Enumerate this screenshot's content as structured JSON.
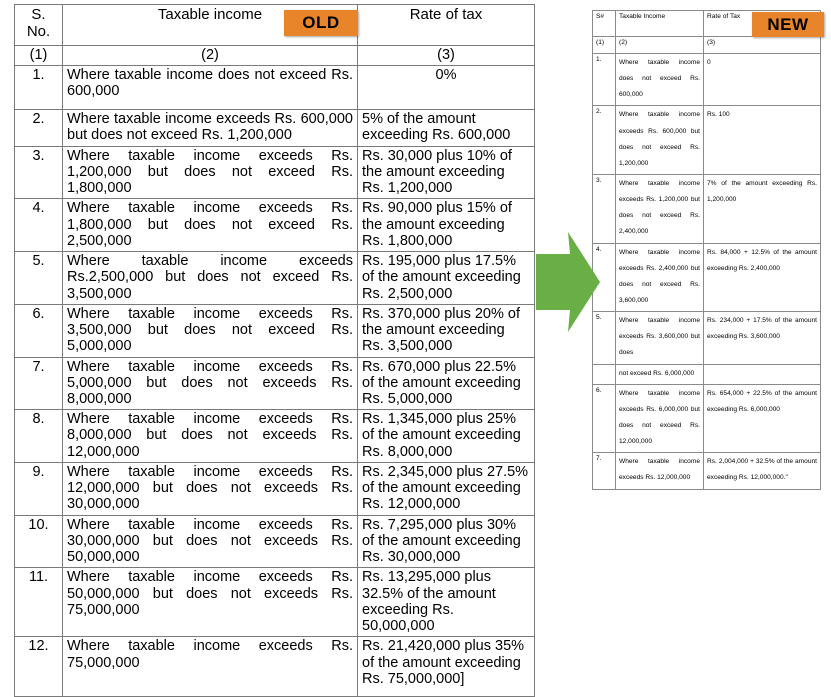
{
  "badges": {
    "old": "OLD",
    "new": "NEW",
    "color": "#E8852A"
  },
  "arrow": {
    "name": "green-right-arrow",
    "color": "#6AAF46",
    "direction": "right"
  },
  "old_table": {
    "headers": {
      "col1": "S.\nNo.",
      "col1_line1": "S.",
      "col1_line2": "No.",
      "col2": "Taxable income",
      "col3": "Rate of tax"
    },
    "numbering": {
      "col1": "(1)",
      "col2": "(2)",
      "col3": "(3)"
    },
    "rows": [
      {
        "sn": "1.",
        "income": "Where taxable income does not exceed Rs. 600,000",
        "rate": "0%"
      },
      {
        "sn": "2.",
        "income": "Where taxable income exceeds Rs. 600,000 but does not exceed Rs. 1,200,000",
        "rate": "5% of the amount exceeding Rs. 600,000"
      },
      {
        "sn": "3.",
        "income": "Where taxable income exceeds Rs. 1,200,000 but does not exceed Rs. 1,800,000",
        "rate": "Rs. 30,000 plus 10% of the amount exceeding Rs. 1,200,000"
      },
      {
        "sn": "4.",
        "income": "Where taxable income exceeds Rs. 1,800,000 but does not exceed Rs. 2,500,000",
        "rate": "Rs. 90,000 plus 15% of the amount exceeding Rs. 1,800,000"
      },
      {
        "sn": "5.",
        "income": "Where taxable income exceeds Rs.2,500,000 but does not exceed Rs. 3,500,000",
        "rate": "Rs. 195,000 plus 17.5% of the amount exceeding Rs. 2,500,000"
      },
      {
        "sn": "6.",
        "income": "Where taxable income exceeds Rs. 3,500,000 but does not exceed Rs. 5,000,000",
        "rate": "Rs. 370,000 plus 20% of the amount exceeding Rs. 3,500,000"
      },
      {
        "sn": "7.",
        "income": "Where taxable income exceeds Rs. 5,000,000 but does not exceeds Rs. 8,000,000",
        "rate": "Rs. 670,000 plus 22.5% of the amount exceeding Rs. 5,000,000"
      },
      {
        "sn": "8.",
        "income": "Where taxable income exceeds Rs. 8,000,000 but does not exceeds Rs. 12,000,000",
        "rate": "Rs. 1,345,000 plus 25% of the amount exceeding Rs. 8,000,000"
      },
      {
        "sn": "9.",
        "income": "Where taxable income exceeds Rs. 12,000,000 but does not exceeds Rs. 30,000,000",
        "rate": "Rs. 2,345,000 plus 27.5% of the amount exceeding Rs. 12,000,000"
      },
      {
        "sn": "10.",
        "income": "Where taxable income exceeds Rs. 30,000,000 but does not exceeds Rs. 50,000,000",
        "rate": "Rs. 7,295,000 plus 30% of the amount exceeding Rs. 30,000,000"
      },
      {
        "sn": "11.",
        "income": "Where taxable income exceeds Rs. 50,000,000 but does not exceeds Rs. 75,000,000",
        "rate": "Rs. 13,295,000 plus 32.5% of the amount exceeding Rs. 50,000,000"
      },
      {
        "sn": "12.",
        "income": "Where taxable income exceeds Rs. 75,000,000",
        "rate": "Rs. 21,420,000 plus 35% of the amount exceeding Rs. 75,000,000]"
      }
    ]
  },
  "new_table": {
    "headers": {
      "col1": "S#",
      "col2": "Taxable Income",
      "col3": "Rate of Tax"
    },
    "numbering": {
      "col1": "(1)",
      "col2": "(2)",
      "col3": "(3)"
    },
    "rows": [
      {
        "sn": "1.",
        "income": "Where taxable income does not exceed Rs. 600,000",
        "rate": "0"
      },
      {
        "sn": "2.",
        "income": "Where taxable income exceeds Rs. 600,000 but does not exceed Rs. 1,200,000",
        "rate": "Rs. 100"
      },
      {
        "sn": "3.",
        "income": "Where taxable income exceeds Rs. 1,200,000 but does not exceed Rs. 2,400,000",
        "rate": "7% of the amount exceeding Rs. 1,200,000"
      },
      {
        "sn": "4.",
        "income": "Where taxable income exceeds Rs. 2,400,000 but does not exceed Rs. 3,600,000",
        "rate": "Rs. 84,000 + 12.5% of the amount exceeding Rs. 2,400,000"
      },
      {
        "sn": "5.",
        "income": "Where taxable income exceeds Rs. 3,600,000 but does",
        "income_cont": "not exceed Rs. 6,000,000",
        "rate": "Rs. 234,000 + 17.5% of the amount exceeding Rs. 3,600,000",
        "rate_cont": ""
      },
      {
        "sn": "6.",
        "income": "Where taxable income exceeds Rs. 6,000,000 but does not exceed Rs. 12,000,000",
        "rate": "Rs. 654,000 + 22.5% of the amount exceeding Rs. 6,000,000"
      },
      {
        "sn": "7.",
        "income": "Where taxable income exceeds Rs. 12,000,000",
        "rate": "Rs. 2,004,000 + 32.5% of the amount exceeding Rs. 12,000,000.\""
      }
    ]
  }
}
